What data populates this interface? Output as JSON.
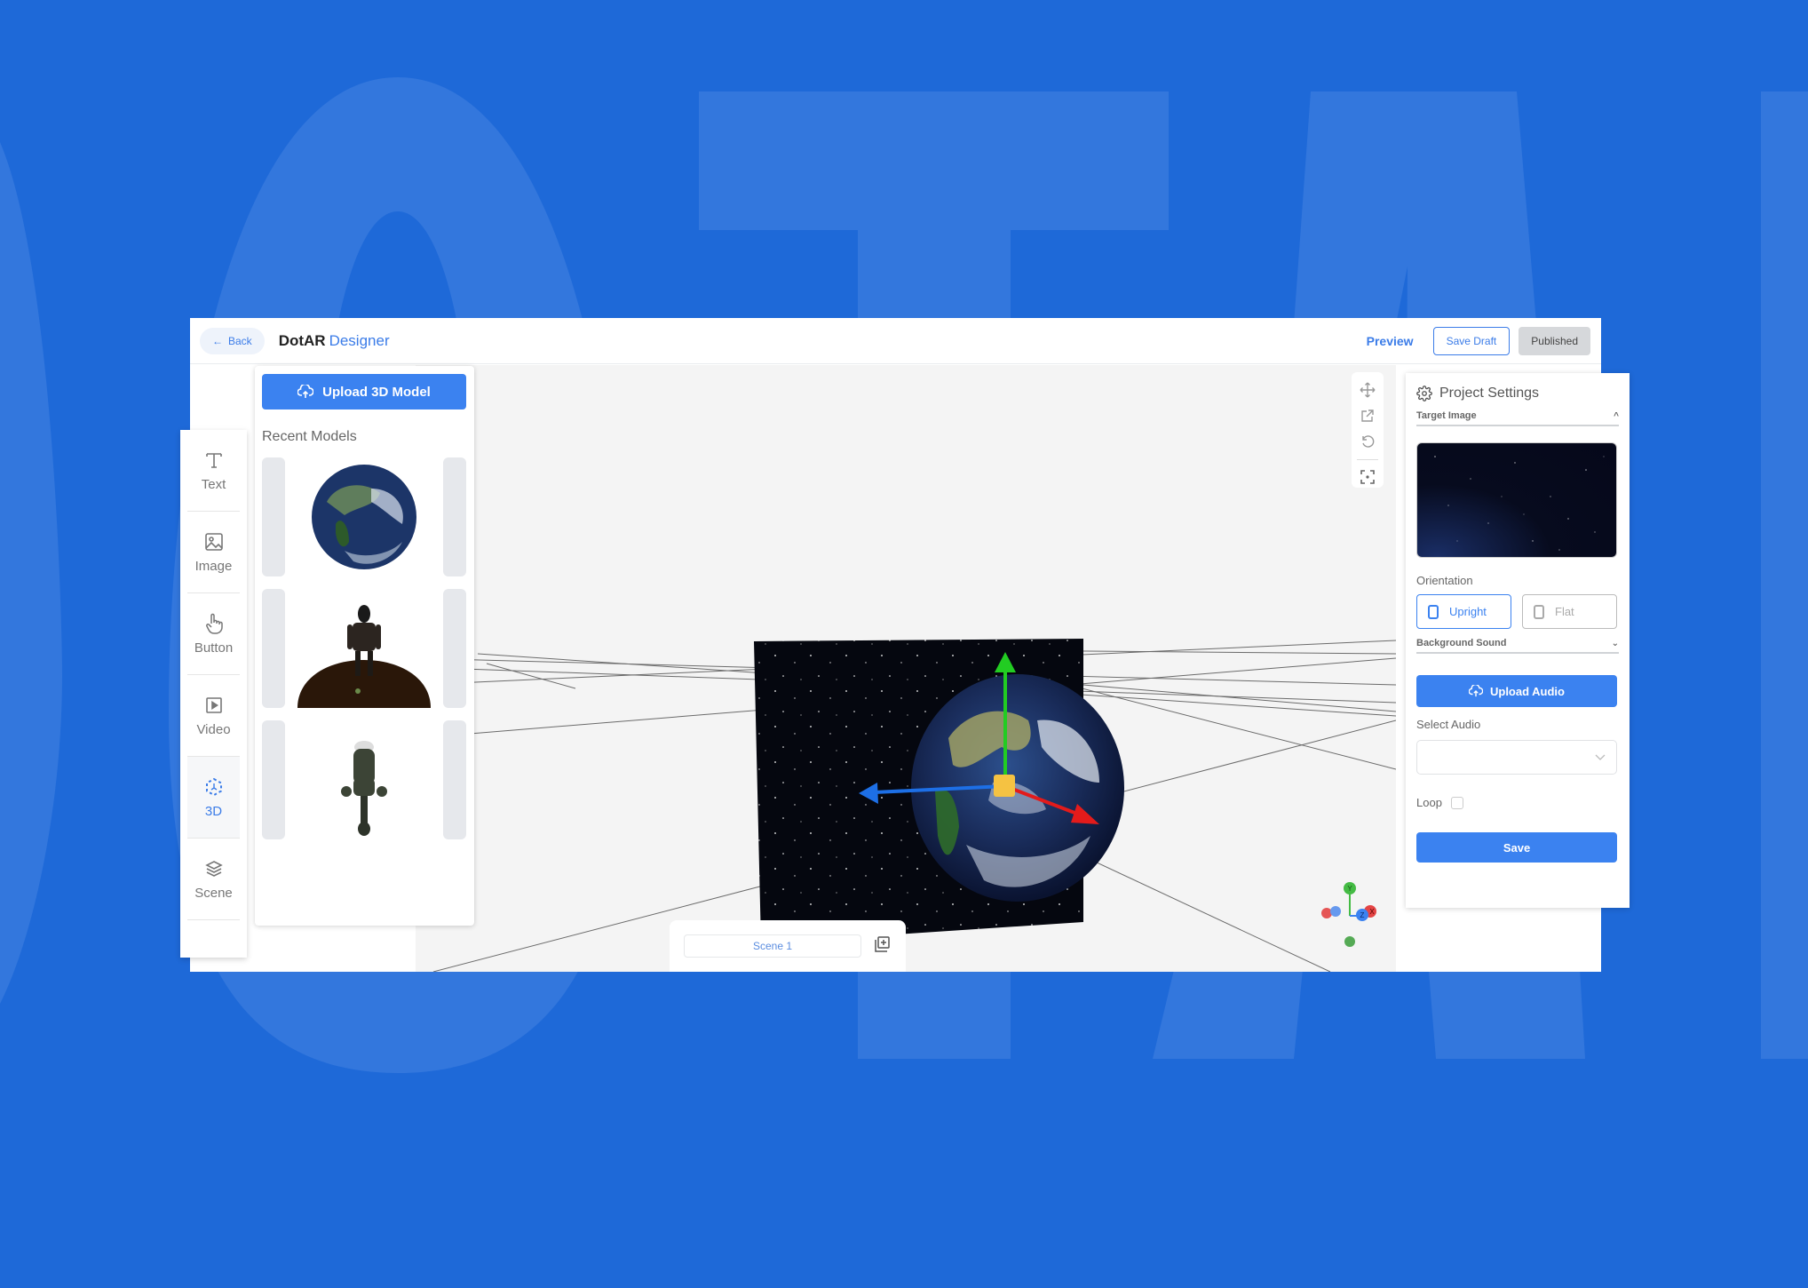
{
  "background": {
    "watermark_text": "DOTAR"
  },
  "header": {
    "back_label": "Back",
    "app_name": "DotAR",
    "app_name_accent": "Designer",
    "preview_label": "Preview",
    "save_draft_label": "Save Draft",
    "published_label": "Published"
  },
  "left_toolbar": {
    "items": [
      {
        "label": "Text",
        "icon": "text-icon",
        "active": false
      },
      {
        "label": "Image",
        "icon": "image-icon",
        "active": false
      },
      {
        "label": "Button",
        "icon": "hand-pointer-icon",
        "active": false
      },
      {
        "label": "Video",
        "icon": "video-icon",
        "active": false
      },
      {
        "label": "3D",
        "icon": "3d-cube-icon",
        "active": true
      },
      {
        "label": "Scene",
        "icon": "layers-icon",
        "active": false
      }
    ]
  },
  "models_panel": {
    "upload_label": "Upload 3D Model",
    "recent_title": "Recent Models",
    "models": [
      {
        "name": "earth-globe"
      },
      {
        "name": "robot-on-platform"
      },
      {
        "name": "character-figure"
      }
    ]
  },
  "viewport": {
    "tools": [
      "move-icon",
      "external-link-icon",
      "reset-rotate-icon",
      "focus-icon"
    ],
    "scene_name": "Scene 1",
    "add_scene_icon": "add-scene-icon",
    "gizmo_axes": [
      "X",
      "Y",
      "Z"
    ],
    "colors": {
      "x_axis": "#e31b1b",
      "y_axis": "#22cc22",
      "z_axis": "#1d6fe6",
      "handle": "#f5c242"
    }
  },
  "settings_panel": {
    "title": "Project Settings",
    "target_image_label": "Target Image",
    "orientation_label": "Orientation",
    "orientation_options": [
      {
        "label": "Upright",
        "selected": true
      },
      {
        "label": "Flat",
        "selected": false
      }
    ],
    "background_sound_label": "Background Sound",
    "upload_audio_label": "Upload Audio",
    "select_audio_label": "Select Audio",
    "select_audio_value": "",
    "loop_label": "Loop",
    "loop_checked": false,
    "save_label": "Save"
  },
  "colors": {
    "brand_blue": "#3b82f0",
    "page_bg": "#1e69d8"
  }
}
